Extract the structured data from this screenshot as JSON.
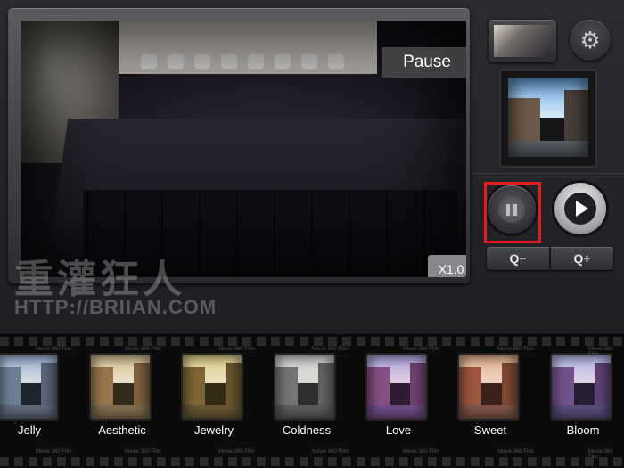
{
  "preview": {
    "state_label": "Pause",
    "zoom_label": "X1.0"
  },
  "controls": {
    "zoom_out_label": "Q−",
    "zoom_in_label": "Q+",
    "settings_icon": "gear-icon",
    "highlight_color": "#e31b1b"
  },
  "watermark": {
    "title": "重灌狂人",
    "url": "HTTP://BRIIAN.COM"
  },
  "film": {
    "brand": "Movie 360 Film"
  },
  "filters": [
    {
      "label": "Jelly",
      "sky": "#9fb6d6",
      "wall": "#6c7a8a",
      "road": "#5a6169",
      "tint": "rgba(120,150,200,.18)"
    },
    {
      "label": "Aesthetic",
      "sky": "#d9c59a",
      "wall": "#8a6a48",
      "road": "#6d5f4e",
      "tint": "rgba(210,170,100,.2)"
    },
    {
      "label": "Jewelry",
      "sky": "#e8dca0",
      "wall": "#6b5236",
      "road": "#4d4331",
      "tint": "rgba(200,170,60,.22)"
    },
    {
      "label": "Coldness",
      "sky": "#e4e4e4",
      "wall": "#6a6a6a",
      "road": "#4a4a4a",
      "tint": "rgba(150,150,150,.25)"
    },
    {
      "label": "Love",
      "sky": "#a7b8e6",
      "wall": "#7a4d73",
      "road": "#5b4a73",
      "tint": "rgba(180,90,200,.22)"
    },
    {
      "label": "Sweet",
      "sky": "#e9c39c",
      "wall": "#8c4e3a",
      "road": "#6a4d46",
      "tint": "rgba(220,120,80,.22)"
    },
    {
      "label": "Bloom",
      "sky": "#b9c9ef",
      "wall": "#6b4b7a",
      "road": "#4d4866",
      "tint": "rgba(150,110,210,.2)"
    }
  ]
}
